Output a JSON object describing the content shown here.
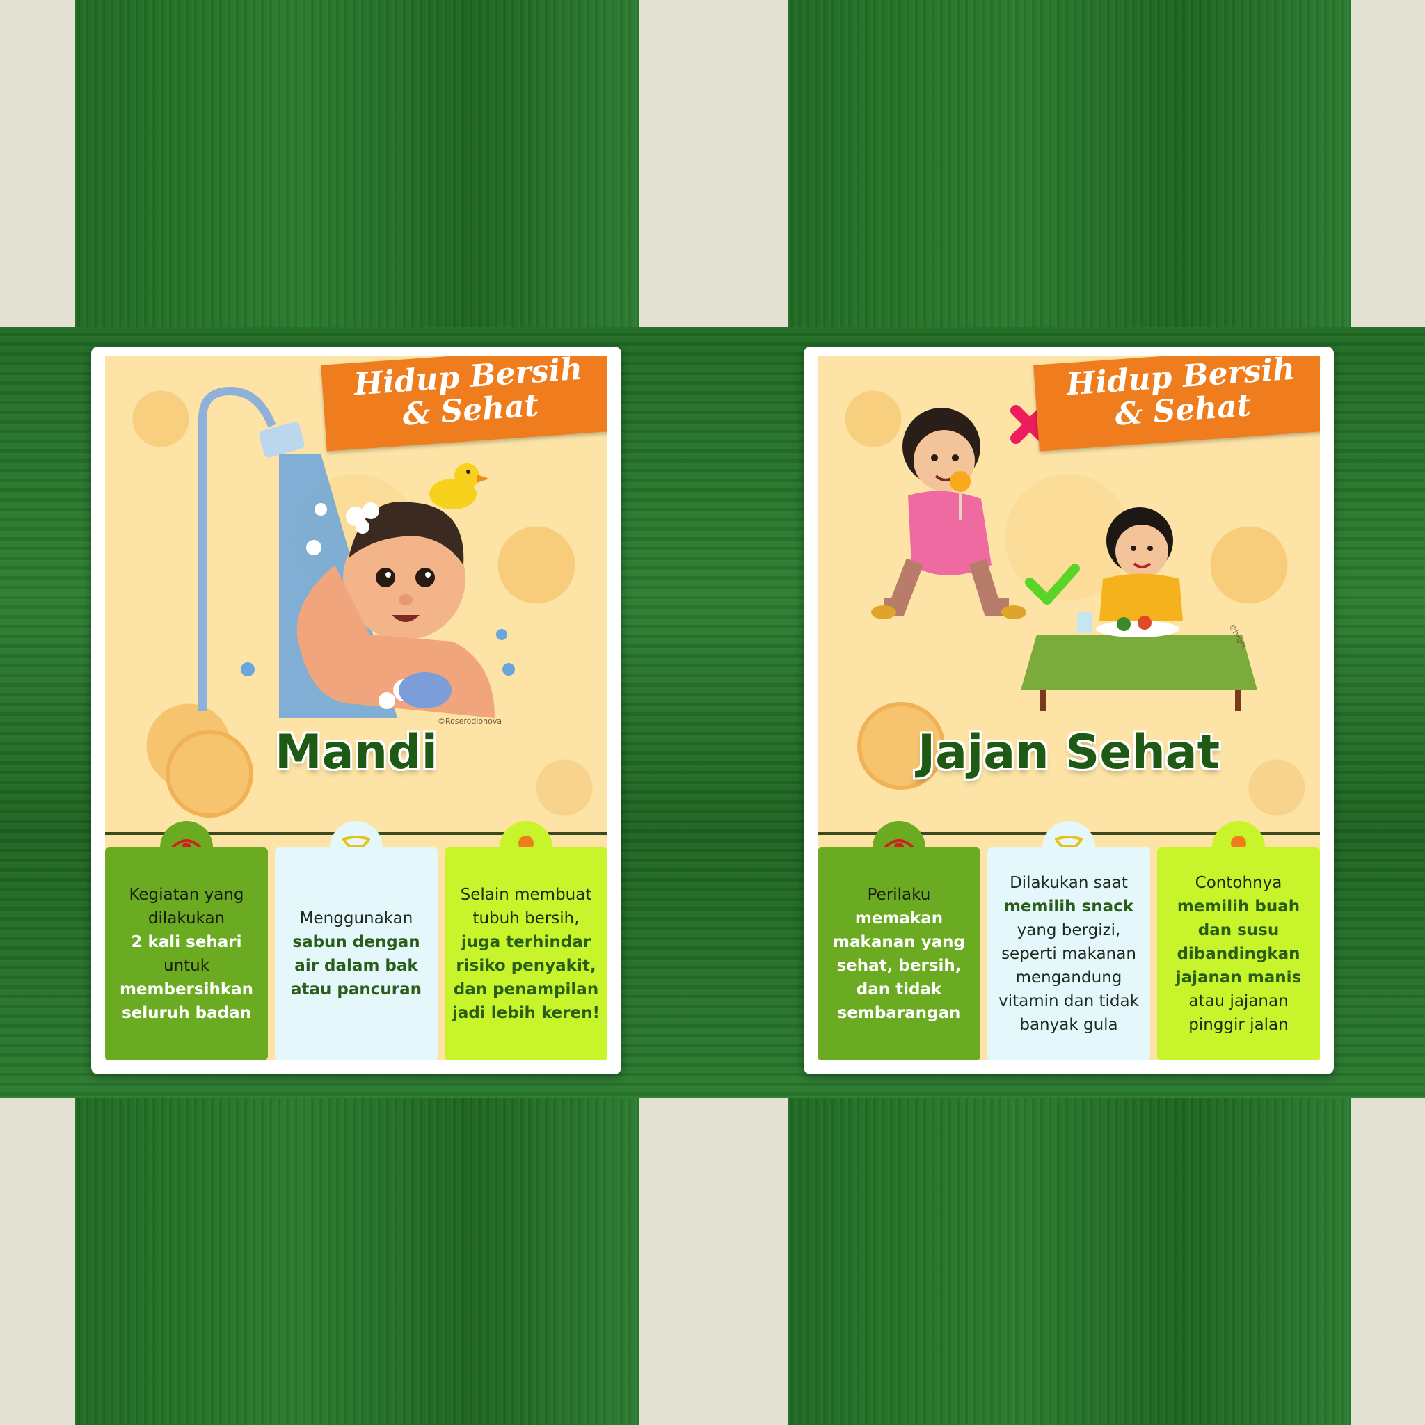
{
  "colors": {
    "green_stripe": "#2a7a2e",
    "beige_background": "#e2e1d2",
    "banner_orange": "#f07d1d",
    "title_green": "#1e5a13",
    "box_green": "#6bab22",
    "box_light": "#e4f7fb",
    "box_lime": "#c7f42a"
  },
  "cards": [
    {
      "banner_line1": "Hidup Bersih",
      "banner_line2": "& Sehat",
      "title": "Mandi",
      "credit": "©Roserodionova",
      "icons": [
        "eye-icon",
        "tongue-icon",
        "lightbulb-icon"
      ],
      "box1": [
        "Kegiatan yang",
        "dilakukan",
        "2 kali sehari",
        "untuk",
        "membersihkan",
        "seluruh badan"
      ],
      "box2": [
        "Menggunakan",
        "sabun dengan",
        "air dalam bak",
        "atau pancuran"
      ],
      "box3": [
        "Selain membuat",
        "tubuh bersih,",
        "juga terhindar",
        "risiko penyakit,",
        "dan penampilan",
        "jadi lebih keren!"
      ]
    },
    {
      "banner_line1": "Hidup Bersih",
      "banner_line2": "& Sehat",
      "title": "Jajan Sehat",
      "credit": "©brgfx",
      "icons": [
        "eye-icon",
        "tongue-icon",
        "lightbulb-icon"
      ],
      "box1": [
        "Perilaku",
        "memakan",
        "makanan yang",
        "sehat, bersih,",
        "dan tidak",
        "sembarangan"
      ],
      "box2": [
        "Dilakukan saat",
        "memilih snack",
        "yang bergizi,",
        "seperti makanan",
        "mengandung",
        "vitamin dan tidak",
        "banyak gula"
      ],
      "box3": [
        "Contohnya",
        "memilih buah",
        "dan susu",
        "dibandingkan",
        "jajanan manis",
        "atau jajanan",
        "pinggir jalan"
      ]
    }
  ]
}
